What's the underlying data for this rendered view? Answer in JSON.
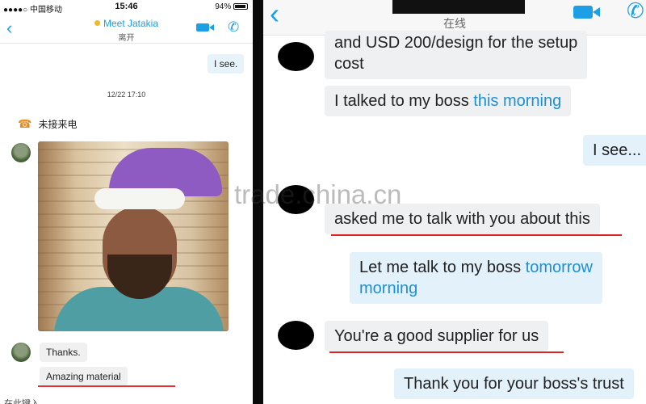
{
  "left": {
    "status_bar": {
      "carrier": "●●●●○ 中国移动",
      "time": "15:46",
      "battery": "94%"
    },
    "header": {
      "back_glyph": "‹",
      "contact_name": "Meet Jatakia",
      "presence": "离开",
      "presence_color": "#f3b829",
      "icons": [
        "back-icon",
        "video-call-icon",
        "phone-call-icon"
      ]
    },
    "messages": {
      "outgoing_1": "I see.",
      "timestamp": "12/22 17:10",
      "missed_call": "未接来电",
      "incoming_1": "Thanks.",
      "incoming_2": "Amazing material"
    },
    "bottom_partial_text": "在此键入..."
  },
  "right": {
    "header": {
      "status": "在线",
      "icons": [
        "back-icon",
        "video-call-icon",
        "phone-call-icon"
      ]
    },
    "messages": [
      {
        "dir": "in",
        "lines": [
          "and USD 200/design for the setup",
          "cost"
        ]
      },
      {
        "dir": "in",
        "text": "I talked to my boss ",
        "highlight": "this morning"
      },
      {
        "dir": "out",
        "text": "I see..."
      },
      {
        "dir": "in",
        "text": "asked me to talk with you about this"
      },
      {
        "dir": "out",
        "text": "Let me talk to my boss ",
        "highlight": "tomorrow",
        "line2": "morning"
      },
      {
        "dir": "in",
        "text": "You're a good supplier for us"
      },
      {
        "dir": "out",
        "text": "Thank you for your boss's trust"
      }
    ]
  },
  "watermark": "trade.china.cn",
  "colors": {
    "accent": "#1d9fe6",
    "outgoing_bubble": "#e3f1fb",
    "incoming_bubble": "#eef0f2",
    "underline": "#d22222",
    "missed_call_icon": "#e58a1d"
  }
}
